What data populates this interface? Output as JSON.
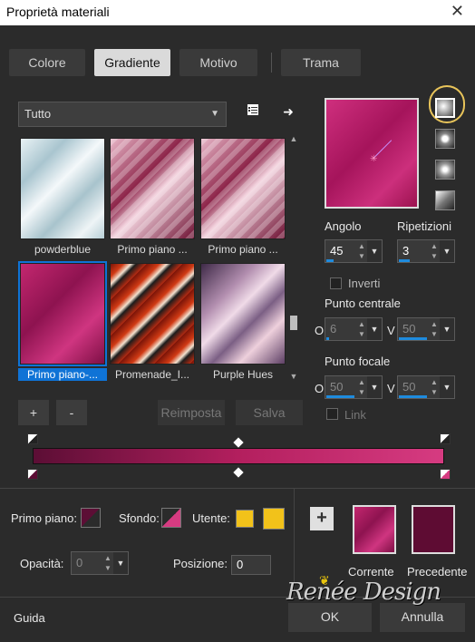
{
  "window": {
    "title": "Proprietà materiali"
  },
  "tabs": [
    {
      "label": "Colore"
    },
    {
      "label": "Gradiente"
    },
    {
      "label": "Motivo"
    },
    {
      "label": "Trama"
    }
  ],
  "category": {
    "selected": "Tutto"
  },
  "gallery": {
    "items": [
      {
        "label": "powderblue"
      },
      {
        "label": "Primo piano ..."
      },
      {
        "label": "Primo piano ..."
      },
      {
        "label": "Primo piano-..."
      },
      {
        "label": "Promenade_I..."
      },
      {
        "label": "Purple Hues"
      }
    ],
    "add": "+",
    "remove": "-",
    "reset": "Reimposta",
    "save": "Salva"
  },
  "params": {
    "angle_label": "Angolo",
    "angle_value": "45",
    "repeat_label": "Ripetizioni",
    "repeat_value": "3",
    "invert_label": "Inverti",
    "center_label": "Punto centrale",
    "center_h_label": "O",
    "center_h_value": "6",
    "center_v_label": "V",
    "center_v_value": "50",
    "focal_label": "Punto focale",
    "focal_h_label": "O",
    "focal_h_value": "50",
    "focal_v_label": "V",
    "focal_v_value": "50",
    "link_label": "Link"
  },
  "colors": {
    "foreground_label": "Primo piano:",
    "background_label": "Sfondo:",
    "user_label": "Utente:",
    "opacity_label": "Opacità:",
    "opacity_value": "0",
    "position_label": "Posizione:",
    "position_value": "0",
    "current_label": "Corrente",
    "previous_label": "Precedente",
    "accent": "#1e8bde",
    "gradient_start": "#5c0e35",
    "gradient_end": "#d63b81"
  },
  "footer": {
    "help": "Guida",
    "ok": "OK",
    "cancel": "Annulla",
    "watermark": "Renée Design"
  }
}
